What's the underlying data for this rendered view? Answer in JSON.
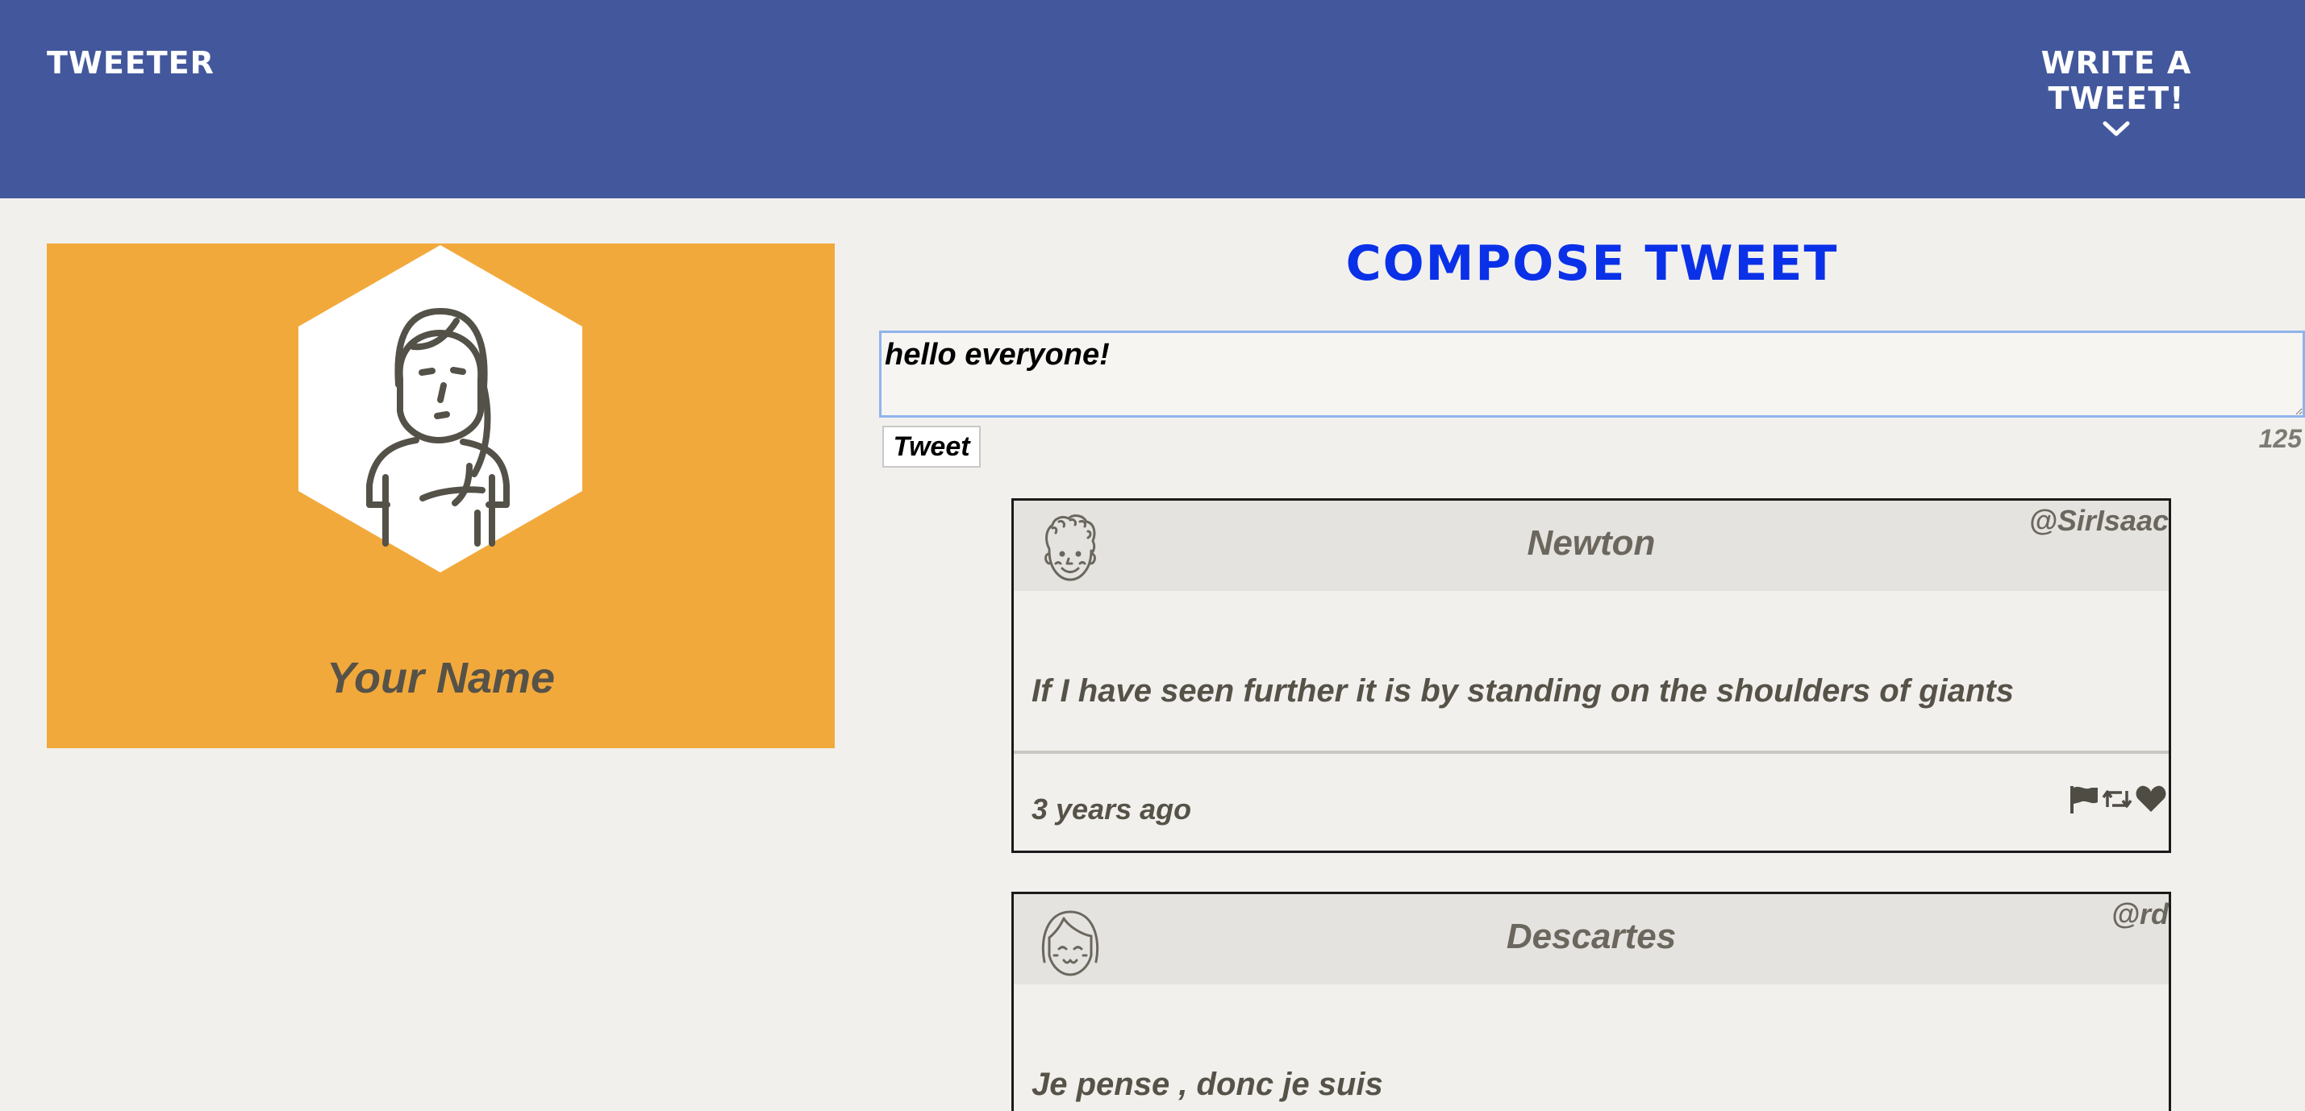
{
  "nav": {
    "brand": "Tweeter",
    "write_label": "Write a tweet!",
    "chevron_icon": "chevron-down-icon"
  },
  "profile": {
    "name": "Your Name",
    "avatar_icon": "girl-avatar-icon",
    "background_color": "#f2a93b"
  },
  "compose": {
    "title": "Compose Tweet",
    "input_value": "hello everyone!",
    "button_label": "Tweet",
    "counter": "125"
  },
  "tweets": [
    {
      "author": "Newton",
      "handle": "@SirIsaac",
      "text": "If I have seen further it is by standing on the shoulders of giants",
      "time": "3 years ago",
      "avatar_icon": "curly-hair-face-icon",
      "actions": [
        "flag-icon",
        "retweet-icon",
        "heart-icon"
      ]
    },
    {
      "author": "Descartes",
      "handle": "@rd",
      "text": "Je pense , donc je suis",
      "avatar_icon": "bob-hair-face-icon"
    }
  ],
  "colors": {
    "nav": "#43589c",
    "page": "#f1f0ed",
    "accent_title": "#0a31e8",
    "text": "#565248"
  }
}
